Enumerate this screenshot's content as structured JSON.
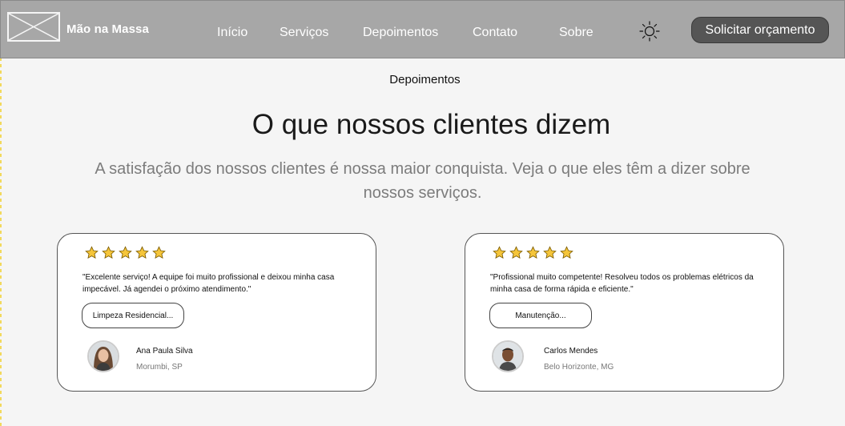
{
  "nav": {
    "logo_text": "Mão na Massa",
    "links": [
      "Início",
      "Serviços",
      "Depoimentos",
      "Contato",
      "Sobre"
    ],
    "theme_toggle_icon": "sun-icon",
    "cta_label": "Solicitar orçamento"
  },
  "section": {
    "eyebrow": "Depoimentos",
    "title": "O que nossos clientes dizem",
    "subtitle": "A satisfação dos nossos clientes é nossa maior conquista. Veja o que eles têm a dizer sobre nossos serviços."
  },
  "testimonials": [
    {
      "rating": 5,
      "quote": "\"Excelente serviço! A equipe foi muito profissional e deixou minha casa impecável. Já agendei o próximo atendimento.\"",
      "service_tag": "Limpeza Residencial...",
      "author": "Ana Paula Silva",
      "location": "Morumbi, SP"
    },
    {
      "rating": 5,
      "quote": "\"Profissional muito competente! Resolveu todos os problemas elétricos da minha casa de forma rápida e eficiente.\"",
      "service_tag": "Manutenção...",
      "author": "Carlos Mendes",
      "location": "Belo Horizonte, MG"
    }
  ],
  "colors": {
    "navbar_bg": "#a7a7a7",
    "cta_bg": "#555555",
    "star_fill": "#f5c53a",
    "subtitle_text": "#7c7c7c"
  }
}
